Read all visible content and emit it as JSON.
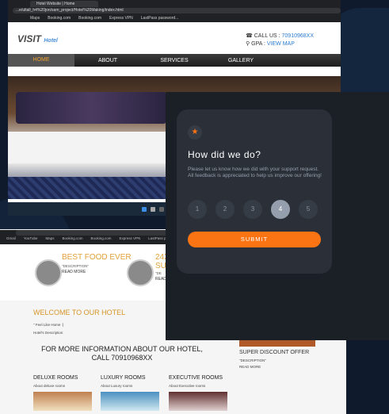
{
  "browser": {
    "tab_title": "Hotel Website | Home",
    "url": "...e/ultall_h4%20jon/sam_project/Hotel%20Making/index.html",
    "bookmarks": [
      "Maps",
      "Booking.com",
      "Booking.com",
      "Express VPN",
      "LastPass password..."
    ],
    "bookmarks2": [
      "Gmail",
      "YouTube",
      "Maps",
      "Booking.com",
      "Booking.com",
      "Express VPN",
      "LastPass password..."
    ]
  },
  "site": {
    "logo": "VISIT",
    "logo_suffix": "Hotel",
    "call_label": "CALL US :",
    "call_number": "70910968XX",
    "gpa_label": "GPA :",
    "gpa_link": "VIEW MAP",
    "nav": [
      "HOME",
      "ABOUT",
      "SERVICES",
      "GALLERY"
    ],
    "features": [
      {
        "title": "BEST FOOD EVER",
        "desc": "\"DESCRIPTION\"",
        "more": "READ MORE"
      },
      {
        "title": "24X",
        "title2": "SU",
        "desc": "\"DE",
        "more": "READ"
      }
    ],
    "welcome": "WELCOME TO OUR HOTEL",
    "feel_home": "\" Feel Like Home :)",
    "hotel_desc": "Hotel's Description",
    "info_line1": "FOR MORE INFORMATION ABOUT OUR HOTEL,",
    "info_line2": "CALL 70910968XX",
    "promo_title": "SUPER DISCOUNT OFFER",
    "promo_desc": "\"DESCRIPTION\"",
    "promo_more": "READ MORE",
    "rooms": [
      {
        "title": "DELUXE ROOMS",
        "sub": "About deluxe rooms"
      },
      {
        "title": "LUXURY ROOMS",
        "sub": "About Luxury rooms"
      },
      {
        "title": "EXECUTIVE ROOMS",
        "sub": "About Executive rooms"
      }
    ]
  },
  "feedback": {
    "title": "How did we do?",
    "message": "Please let us know how we did with your support request. All feedback is appreciated to help us improve our offering!",
    "ratings": [
      "1",
      "2",
      "3",
      "4",
      "5"
    ],
    "selected_rating": "4",
    "submit_label": "SUBMIT",
    "accent_color": "#fb7413",
    "icon": "star-icon"
  }
}
